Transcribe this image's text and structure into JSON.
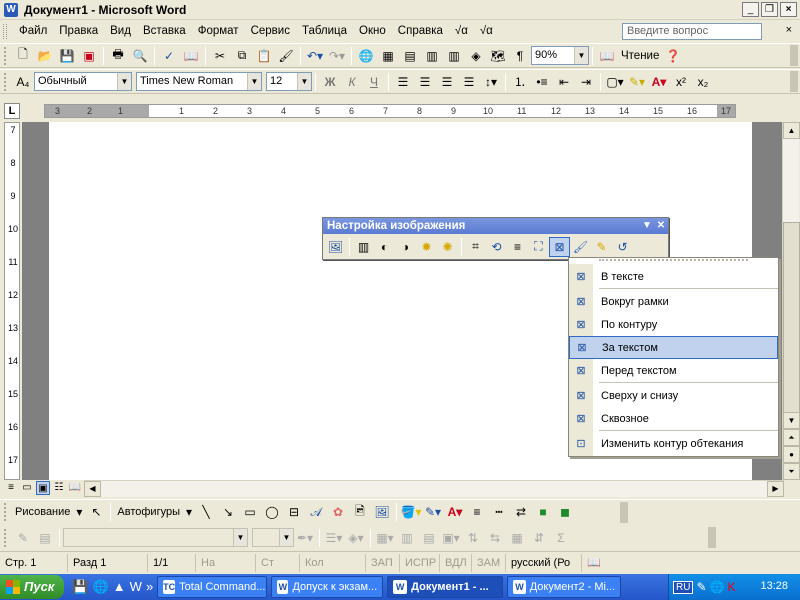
{
  "window": {
    "title": "Документ1 - Microsoft Word",
    "app_icon": "W"
  },
  "menubar": {
    "items": [
      "Файл",
      "Правка",
      "Вид",
      "Вставка",
      "Формат",
      "Сервис",
      "Таблица",
      "Окно",
      "Справка"
    ],
    "help_placeholder": "Введите вопрос",
    "close_glyph": "×"
  },
  "standard_toolbar": {
    "zoom": "90%",
    "read_label": "Чтение",
    "paragraph_glyph": "¶"
  },
  "formatting_toolbar": {
    "style": "Обычный",
    "font": "Times New Roman",
    "size": "12",
    "bold": "Ж",
    "italic": "К",
    "underline": "Ч"
  },
  "ruler": {
    "corner": "L",
    "h_numbers": [
      "3",
      "2",
      "1",
      "1",
      "2",
      "3",
      "4",
      "5",
      "6",
      "7",
      "8",
      "9",
      "10",
      "11",
      "12",
      "13",
      "14",
      "15",
      "16",
      "17"
    ],
    "v_numbers": [
      "7",
      "8",
      "9",
      "10",
      "11",
      "12",
      "13",
      "14",
      "15",
      "16",
      "17"
    ]
  },
  "picture_toolbar": {
    "title": "Настройка изображения"
  },
  "wrap_menu": {
    "items": [
      {
        "label": "В тексте"
      },
      {
        "label": "Вокруг рамки"
      },
      {
        "label": "По контуру"
      },
      {
        "label": "За текстом"
      },
      {
        "label": "Перед текстом"
      },
      {
        "label": "Сверху и снизу"
      },
      {
        "label": "Сквозное"
      },
      {
        "label": "Изменить контур обтекания"
      }
    ],
    "highlighted": "За текстом"
  },
  "drawing_toolbar": {
    "drawing_label": "Рисование",
    "autoshapes_label": "Автофигуры"
  },
  "statusbar": {
    "page": "Стр. 1",
    "section": "Разд 1",
    "pages": "1/1",
    "at": "На",
    "line": "Ст",
    "col": "Кол",
    "rec": "ЗАП",
    "trk": "ИСПР",
    "ext": "ВДЛ",
    "ovr": "ЗАМ",
    "language": "русский (Ро"
  },
  "taskbar": {
    "start_label": "Пуск",
    "tasks": [
      "Total Command...",
      "Допуск к экзам...",
      "Документ1 - ...",
      "Документ2 - Mi..."
    ],
    "active_task": "Документ1 - ...",
    "lang": "RU",
    "clock": "13:28"
  }
}
